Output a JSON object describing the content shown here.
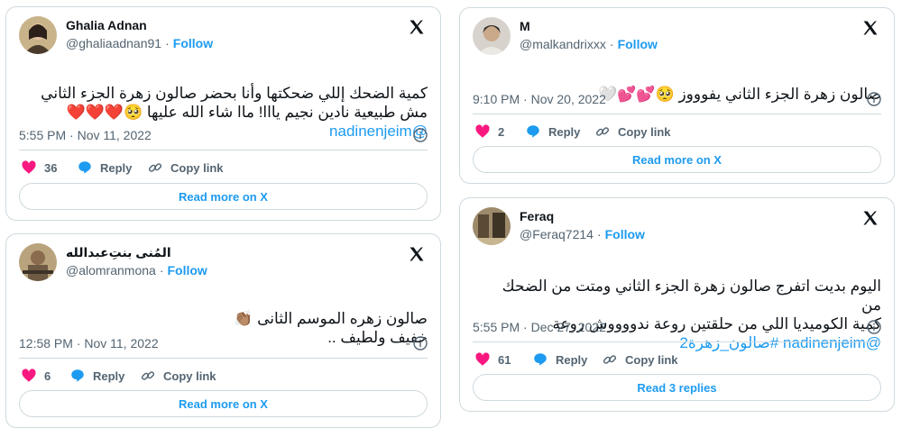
{
  "follow_label": "Follow",
  "reply_label": "Reply",
  "copy_label": "Copy link",
  "tweets": [
    {
      "name": "Ghalia Adnan",
      "handle": "@ghaliaadnan91",
      "text": "كمية الضحك إللي ضحكتها وأنا بحضر صالون زهرة الجزء الثاني\nمش طبيعية نادين نجيم يااا! ماا شاء الله عليها 🥺❤️❤️❤️",
      "mention": "@nadinenjeim",
      "time": "5:55 PM · Nov 11, 2022",
      "likes": "36",
      "button": "Read more on X"
    },
    {
      "name": "المُنى بنتِ‌عبدالله",
      "handle": "@alomranmona",
      "text": "صالون زهره الموسم الثانى 👏🏽\nخفيف ولطيف ..",
      "mention": "",
      "time": "12:58 PM · Nov 11, 2022",
      "likes": "6",
      "button": "Read more on X"
    },
    {
      "name": "M",
      "handle": "@malkandrixxx",
      "text": "صالون زهرة الجزء الثاني يفوووز 🥺💕💕🤍",
      "mention": "",
      "time": "9:10 PM · Nov 20, 2022",
      "likes": "2",
      "button": "Read more on X"
    },
    {
      "name": "Feraq",
      "handle": "@Feraq7214",
      "text": "اليوم بديت اتفرج صالون زهرة الجزء الثاني ومتت من الضحك من\nكمية الكوميديا اللي من حلقتين روعة ندووووش روعة",
      "mention": "@nadinenjeim #صالون_زهرة2",
      "time": "5:55 PM · Dec 27, 2022",
      "likes": "61",
      "button": "Read 3 replies"
    }
  ],
  "colors": {
    "like": "#f91880",
    "reply": "#1d9bf0",
    "link": "#1d9bf0",
    "muted": "#536471",
    "border": "#cfd9de"
  },
  "icons": [
    "x-logo-icon",
    "info-icon",
    "heart-icon",
    "reply-bubble-icon",
    "link-icon"
  ]
}
